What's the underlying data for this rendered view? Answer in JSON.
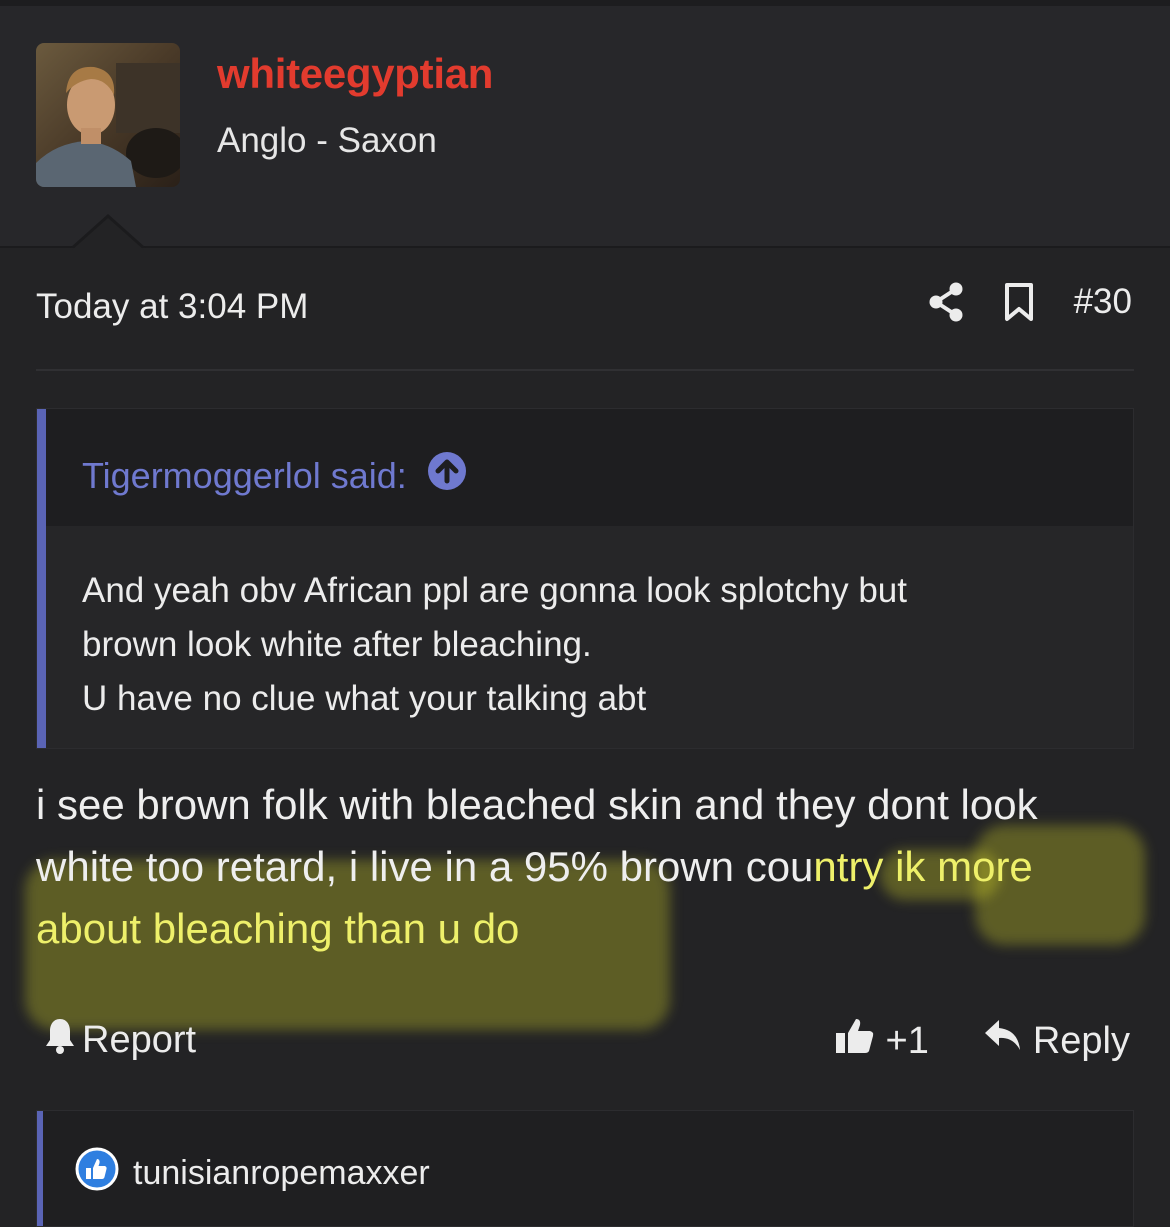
{
  "user": {
    "name": "whiteegyptian",
    "title": "Anglo - Saxon"
  },
  "meta": {
    "time": "Today at 3:04 PM",
    "post_number": "#30",
    "share_icon": "share-icon",
    "bookmark_icon": "bookmark-icon"
  },
  "quote": {
    "author_said": "Tigermoggerlol said:",
    "lines": [
      "And yeah obv African ppl are gonna look splotchy but",
      "brown look white after bleaching.",
      "U have no clue what your talking abt"
    ]
  },
  "post": {
    "line1": "i see brown folk with bleached skin and they dont look",
    "line2_plain": "white too retard, i live in a 95% brown cou",
    "line2_highlight": "ntry ik more",
    "line3_highlight": "about bleaching than u do"
  },
  "actions": {
    "report_label": "Report",
    "like_count": "+1",
    "reply_label": "Reply"
  },
  "reactions": {
    "users": "tunisianropemaxxer"
  },
  "colors": {
    "username": "#e23b2e",
    "quote_accent": "#5a64b5",
    "highlight": "#e6e628"
  }
}
